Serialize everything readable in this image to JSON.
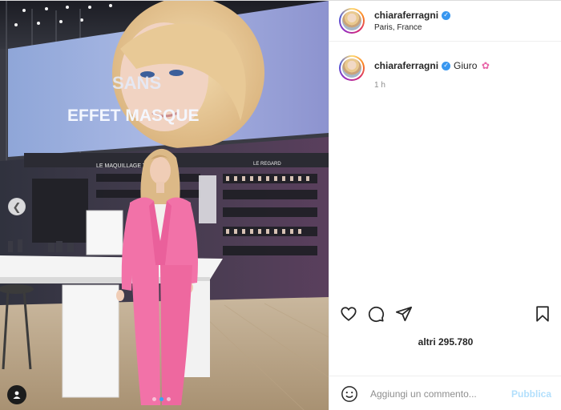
{
  "post": {
    "username": "chiaraferragni",
    "location": "Paris, France",
    "caption": "Giuro",
    "caption_emoji": "✿",
    "time_ago": "1 h",
    "likes_text": "altri 295.780",
    "comment_placeholder": "Aggiungi un commento...",
    "publish_label": "Pubblica",
    "carousel_dots": 3,
    "carousel_active": 1
  },
  "photo": {
    "billboard_line1": "SANS",
    "billboard_line2": "EFFET MASQUE",
    "shelf_sign_left": "LE MAQUILLAGE  TEINT",
    "shelf_sign_right": "LE REGARD"
  },
  "icons": {
    "heart": "heart-icon",
    "comment": "comment-icon",
    "share": "share-icon",
    "save": "bookmark-icon",
    "emoji": "emoji-icon",
    "prev": "chevron-left-icon",
    "tag": "user-tag-icon",
    "verified": "verified-badge-icon"
  },
  "colors": {
    "verified_blue": "#3897f0",
    "publish_disabled": "#b2dffc",
    "suit_pink": "#f272a8",
    "carousel_active": "#3aa2f7"
  }
}
